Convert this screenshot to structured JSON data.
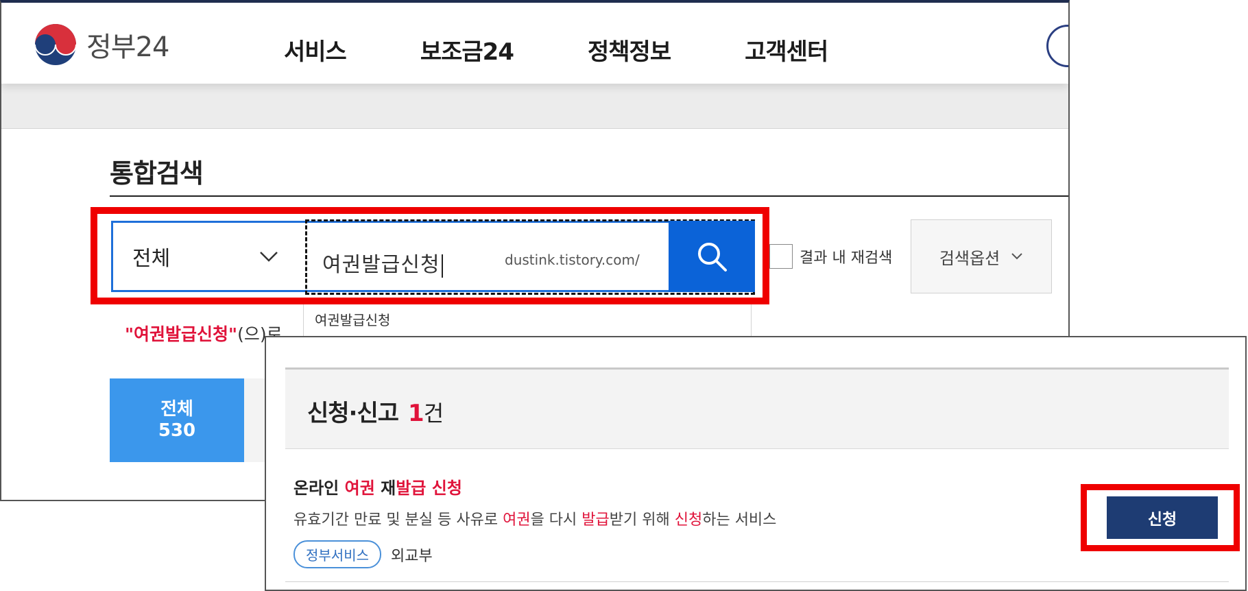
{
  "header": {
    "logo_text": "정부24",
    "nav": [
      "서비스",
      "보조금24",
      "정책정보",
      "고객센터"
    ]
  },
  "search": {
    "page_title": "통합검색",
    "scope_selected": "전체",
    "query": "여권발급신청",
    "watermark": "dustink.tistory.com/",
    "recheck_label": "결과 내 재검색",
    "options_label": "검색옵션",
    "autocomplete": [
      "여권발급신청"
    ],
    "result_message": {
      "query_quoted": "\"여권발급신청\"",
      "suffix": "(으)로"
    }
  },
  "tabs": [
    {
      "label": "전체",
      "count": "530"
    }
  ],
  "result_panel": {
    "section_title": "신청·신고",
    "count": "1",
    "count_unit": "건",
    "item": {
      "title_parts": [
        "온라인 ",
        "여권",
        " 재",
        "발급",
        " ",
        "신청"
      ],
      "desc_parts": [
        "유효기간 만료 및 분실 등 사유로 ",
        "여권",
        "을 다시 ",
        "발급",
        "받기 위해 ",
        "신청",
        "하는 서비스"
      ],
      "tag": "정부서비스",
      "org": "외교부",
      "apply_label": "신청"
    }
  },
  "colors": {
    "highlight": "#e0133a",
    "primary_blue": "#0b63d8",
    "tab_blue": "#3b97ec",
    "apply_navy": "#1e3c73",
    "annotation_red": "#ef0000"
  },
  "icons": [
    "gov24-logo-icon",
    "chevron-down-icon",
    "search-icon",
    "checkbox-icon"
  ]
}
